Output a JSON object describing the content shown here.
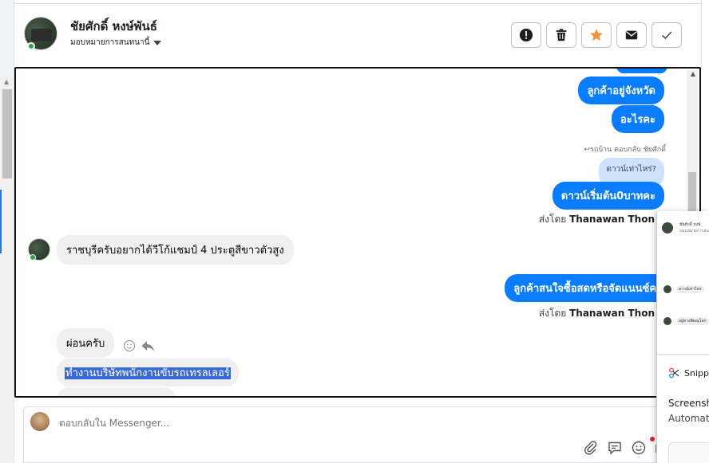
{
  "header": {
    "contact_name": "ชัยศักดิ์ หงษ์พันธ์",
    "assign_label": "มอบหมายการสนทนานี้",
    "actions": [
      {
        "icon": "alert-icon",
        "name": "mark-spam-button"
      },
      {
        "icon": "trash-icon",
        "name": "delete-button"
      },
      {
        "icon": "star-icon",
        "name": "star-button"
      },
      {
        "icon": "envelope-icon",
        "name": "mark-unread-button"
      },
      {
        "icon": "check-icon",
        "name": "mark-done-button"
      }
    ],
    "star_color": "#f7923b"
  },
  "messages": {
    "out_1": "ลูกค้าอยู่จังหวัด",
    "out_2": "อะไรคะ",
    "reply_meta": "รถบ้าน ตอบกลับ ชัยศักดิ์",
    "quoted": "ดาวน์เท่าไหร่?",
    "out_3": "ดาวน์เริ่มต้น0บาทคะ",
    "sent_by_1_prefix": "ส่งโดย",
    "sent_by_1_name": "Thanawan Thon",
    "in_1": "ราชบุรีครับอยากได้วีโก้แชมป์ 4 ประตูสีขาวตัวสูง",
    "out_4": "ลูกค้าสนใจซื้อสดหรือจัดแนนซ์คะ",
    "sent_by_2_prefix": "ส่งโดย",
    "sent_by_2_name": "Thanawan Thon",
    "in_2": "ผ่อนครับ",
    "in_3": "ทำงานบริษัทพนักงานขับรถเทรลเลอร์"
  },
  "composer": {
    "placeholder": "ตอบกลับใน Messenger..."
  },
  "overlay": {
    "mini_name": "ชัยศักดิ์ หงษ์",
    "mini_sub": "มอบหมายการสนทนา",
    "mini_msg_1": "ดาวน์เท่าไหร่",
    "mini_msg_2": "อยู่ทางพิษณุโลก",
    "snip_label": "Snipp",
    "title": "Screensh",
    "subtitle": "Automat"
  },
  "colors": {
    "outgoing_bubble": "#0a7cff",
    "incoming_bubble": "#f0f0f0",
    "selection_highlight": "#3a6ad6"
  }
}
